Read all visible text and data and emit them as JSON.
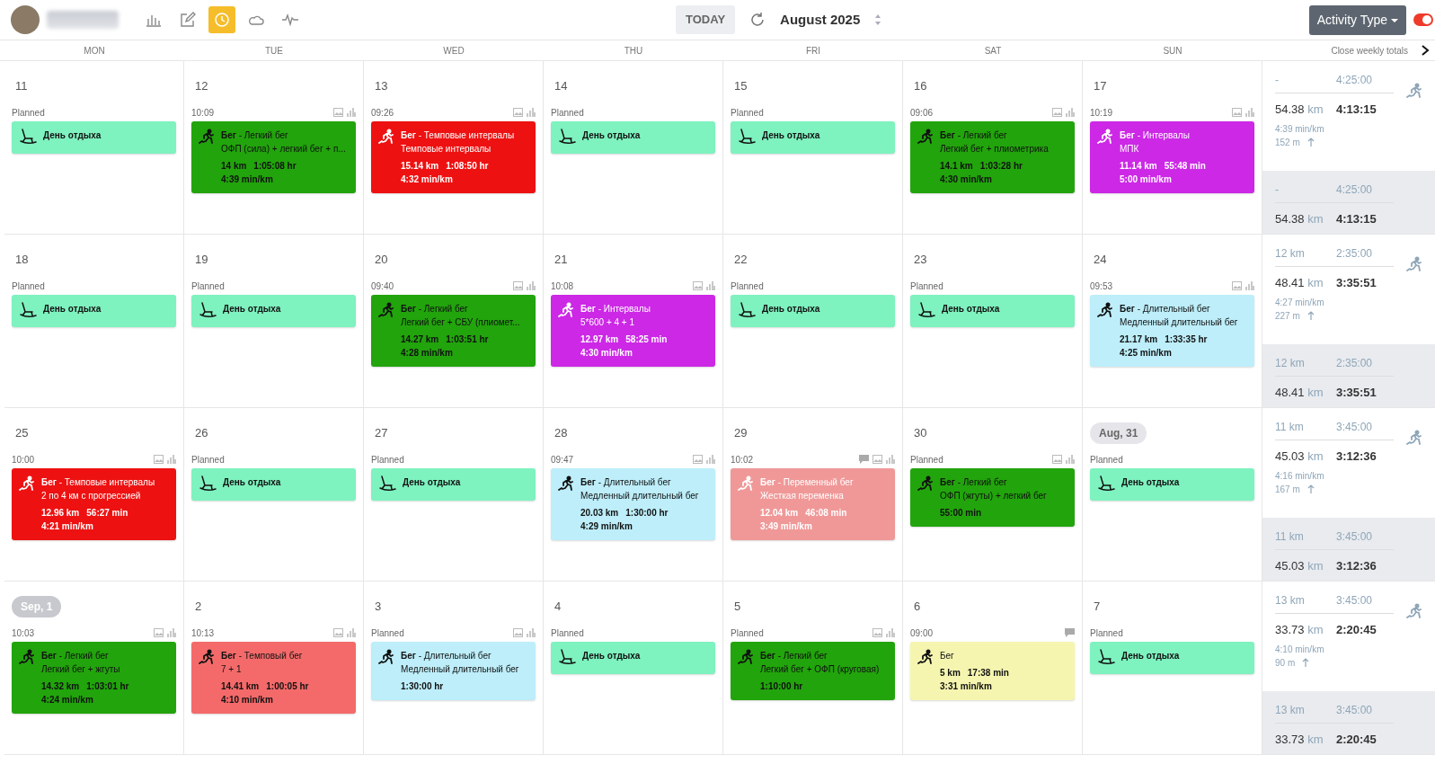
{
  "toolbar": {
    "tools": [
      {
        "kind": "stats",
        "selected": false
      },
      {
        "kind": "edit",
        "selected": false
      },
      {
        "kind": "clock",
        "selected": true
      },
      {
        "kind": "weather",
        "selected": false
      },
      {
        "kind": "pulse",
        "selected": false
      }
    ],
    "today": "TODAY",
    "month": "August 2025",
    "activity_type": "Activity Type",
    "toggle_on": true
  },
  "weekdays": [
    "MON",
    "TUE",
    "WED",
    "THU",
    "FRI",
    "SAT",
    "SUN"
  ],
  "close_totals": "Close weekly totals",
  "weeks": [
    {
      "days": [
        {
          "date": "11",
          "label": "Planned",
          "workout": {
            "kind": "rest",
            "title": "День отдыха"
          }
        },
        {
          "date": "12",
          "label": "10:09",
          "image": true,
          "chart": true,
          "workout": {
            "kind": "run",
            "color": "#22a40c",
            "light_text": false,
            "title": "**Бег** - Легкий бег",
            "subtitle": "ОФП (сила) + легкий бег + п...",
            "stats": [
              "14 km",
              "1:05:08 hr"
            ],
            "pace": "4:39 min/km"
          }
        },
        {
          "date": "13",
          "label": "09:26",
          "image": true,
          "chart": true,
          "workout": {
            "kind": "run",
            "color": "#ee1111",
            "light_text": true,
            "title": "**Бег** - Темповые интервалы",
            "subtitle": "Темповые интервалы",
            "stats": [
              "15.14 km",
              "1:08:50 hr"
            ],
            "pace": "4:32 min/km"
          }
        },
        {
          "date": "14",
          "label": "Planned",
          "workout": {
            "kind": "rest",
            "title": "День отдыха"
          }
        },
        {
          "date": "15",
          "label": "Planned",
          "workout": {
            "kind": "rest",
            "title": "День отдыха"
          }
        },
        {
          "date": "16",
          "label": "09:06",
          "image": true,
          "chart": true,
          "workout": {
            "kind": "run",
            "color": "#22a40c",
            "light_text": false,
            "title": "**Бег** - Легкий бег",
            "subtitle": "Легкий бег + плиометрика",
            "stats": [
              "14.1 km",
              "1:03:28 hr"
            ],
            "pace": "4:30 min/km"
          }
        },
        {
          "date": "17",
          "label": "10:19",
          "image": true,
          "chart": true,
          "workout": {
            "kind": "run",
            "color": "#cc28e6",
            "light_text": true,
            "title": "**Бег** - Интервалы",
            "subtitle": "МПК",
            "stats": [
              "11.14 km",
              "55:48 min"
            ],
            "pace": "5:00 min/km"
          }
        }
      ],
      "totals": {
        "planned_distance": "-",
        "planned_time": "4:25:00",
        "distance": "54.38",
        "unit": "km",
        "time": "4:13:15",
        "pace": "4:39 min/km",
        "elevation": "152 m"
      },
      "summary": {
        "planned_distance": "-",
        "planned_time": "4:25:00",
        "distance": "54.38",
        "unit": "km",
        "time": "4:13:15"
      }
    },
    {
      "days": [
        {
          "date": "18",
          "label": "Planned",
          "workout": {
            "kind": "rest",
            "title": "День отдыха"
          }
        },
        {
          "date": "19",
          "label": "Planned",
          "workout": {
            "kind": "rest",
            "title": "День отдыха"
          }
        },
        {
          "date": "20",
          "label": "09:40",
          "image": true,
          "chart": true,
          "workout": {
            "kind": "run",
            "color": "#22a40c",
            "light_text": false,
            "title": "**Бег** - Легкий бег",
            "subtitle": "Легкий бег + СБУ (плиомет...",
            "stats": [
              "14.27 km",
              "1:03:51 hr"
            ],
            "pace": "4:28 min/km"
          }
        },
        {
          "date": "21",
          "label": "10:08",
          "image": true,
          "chart": true,
          "workout": {
            "kind": "run",
            "color": "#cc28e6",
            "light_text": true,
            "title": "**Бег** - Интервалы",
            "subtitle": "5*600 + 4 + 1",
            "stats": [
              "12.97 km",
              "58:25 min"
            ],
            "pace": "4:30 min/km"
          }
        },
        {
          "date": "22",
          "label": "Planned",
          "workout": {
            "kind": "rest",
            "title": "День отдыха"
          }
        },
        {
          "date": "23",
          "label": "Planned",
          "workout": {
            "kind": "rest",
            "title": "День отдыха"
          }
        },
        {
          "date": "24",
          "label": "09:53",
          "image": true,
          "chart": true,
          "workout": {
            "kind": "run",
            "color": "#bdeefa",
            "light_text": false,
            "title": "**Бег** - Длительный бег",
            "subtitle": "Медленный длительный бег",
            "stats": [
              "21.17 km",
              "1:33:35 hr"
            ],
            "pace": "4:25 min/km"
          }
        }
      ],
      "totals": {
        "planned_distance": "12 km",
        "planned_time": "2:35:00",
        "distance": "48.41",
        "unit": "km",
        "time": "3:35:51",
        "pace": "4:27 min/km",
        "elevation": "227 m"
      },
      "summary": {
        "planned_distance": "12 km",
        "planned_time": "2:35:00",
        "distance": "48.41",
        "unit": "km",
        "time": "3:35:51"
      }
    },
    {
      "days": [
        {
          "date": "25",
          "label": "10:00",
          "image": true,
          "chart": true,
          "workout": {
            "kind": "run",
            "color": "#ee1111",
            "light_text": true,
            "title": "**Бег** - Темповые интервалы",
            "subtitle": "2 по 4 км с прогрессией",
            "stats": [
              "12.96 km",
              "56:27 min"
            ],
            "pace": "4:21 min/km"
          }
        },
        {
          "date": "26",
          "label": "Planned",
          "workout": {
            "kind": "rest",
            "title": "День отдыха"
          }
        },
        {
          "date": "27",
          "label": "Planned",
          "workout": {
            "kind": "rest",
            "title": "День отдыха"
          }
        },
        {
          "date": "28",
          "label": "09:47",
          "image": true,
          "chart": true,
          "workout": {
            "kind": "run",
            "color": "#bdeefa",
            "light_text": false,
            "title": "**Бег** - Длительный бег",
            "subtitle": "Медленный длительный бег",
            "stats": [
              "20.03 km",
              "1:30:00 hr"
            ],
            "pace": "4:29 min/km"
          }
        },
        {
          "date": "29",
          "label": "10:02",
          "comment": true,
          "image": true,
          "chart": true,
          "workout": {
            "kind": "run",
            "color": "#f09898",
            "light_text": true,
            "title": "**Бег** - Переменный бег",
            "subtitle": "Жесткая переменка",
            "stats": [
              "12.04 km",
              "46:08 min"
            ],
            "pace": "3:49 min/km"
          }
        },
        {
          "date": "30",
          "label": "Planned",
          "image": true,
          "chart": true,
          "workout": {
            "kind": "run",
            "color": "#22a40c",
            "light_text": false,
            "title": "**Бег** - Легкий бег",
            "subtitle": "ОФП (жгуты) + легкий бег",
            "stats": [
              "55:00 min"
            ]
          }
        },
        {
          "date": "Aug, 31",
          "badge": true,
          "muted": false,
          "label": "Planned",
          "workout": {
            "kind": "rest",
            "title": "День отдыха"
          }
        }
      ],
      "totals": {
        "planned_distance": "11 km",
        "planned_time": "3:45:00",
        "distance": "45.03",
        "unit": "km",
        "time": "3:12:36",
        "pace": "4:16 min/km",
        "elevation": "167 m"
      },
      "summary": {
        "planned_distance": "11 km",
        "planned_time": "3:45:00",
        "distance": "45.03",
        "unit": "km",
        "time": "3:12:36"
      }
    },
    {
      "days": [
        {
          "date": "Sep, 1",
          "badge": true,
          "muted": true,
          "label": "10:03",
          "image": true,
          "chart": true,
          "workout": {
            "kind": "run",
            "color": "#22a40c",
            "light_text": false,
            "title": "**Бег** - Легкий бег",
            "subtitle": "Легкий бег + жгуты",
            "stats": [
              "14.32 km",
              "1:03:01 hr"
            ],
            "pace": "4:24 min/km"
          }
        },
        {
          "date": "2",
          "label": "10:13",
          "image": true,
          "chart": true,
          "workout": {
            "kind": "run",
            "color": "#f46a6a",
            "light_text": false,
            "title": "**Бег** - Темповый бег",
            "subtitle": "7 + 1",
            "stats": [
              "14.41 km",
              "1:00:05 hr"
            ],
            "pace": "4:10 min/km"
          }
        },
        {
          "date": "3",
          "label": "Planned",
          "image": true,
          "chart": true,
          "workout": {
            "kind": "run",
            "color": "#bdeefa",
            "light_text": false,
            "title": "**Бег** - Длительный бег",
            "subtitle": "Медленный длительный бег",
            "stats": [
              "1:30:00 hr"
            ]
          }
        },
        {
          "date": "4",
          "label": "Planned",
          "workout": {
            "kind": "rest",
            "title": "День отдыха"
          }
        },
        {
          "date": "5",
          "label": "Planned",
          "image": true,
          "chart": true,
          "workout": {
            "kind": "run",
            "color": "#22a40c",
            "light_text": false,
            "title": "**Бег** - Легкий бег",
            "subtitle": "Легкий бег + ОФП (круговая)",
            "stats": [
              "1:10:00 hr"
            ]
          }
        },
        {
          "date": "6",
          "label": "09:00",
          "comment": true,
          "workout": {
            "kind": "run",
            "color": "#f5f5b0",
            "light_text": false,
            "title": "Бег",
            "stats": [
              "5 km",
              "17:38 min"
            ],
            "pace": "3:31 min/km"
          }
        },
        {
          "date": "7",
          "label": "Planned",
          "workout": {
            "kind": "rest",
            "title": "День отдыха"
          }
        }
      ],
      "totals": {
        "planned_distance": "13 km",
        "planned_time": "3:45:00",
        "distance": "33.73",
        "unit": "km",
        "time": "2:20:45",
        "pace": "4:10 min/km",
        "elevation": "90 m"
      },
      "summary": {
        "planned_distance": "13 km",
        "planned_time": "3:45:00",
        "distance": "33.73",
        "unit": "km",
        "time": "2:20:45"
      }
    }
  ]
}
